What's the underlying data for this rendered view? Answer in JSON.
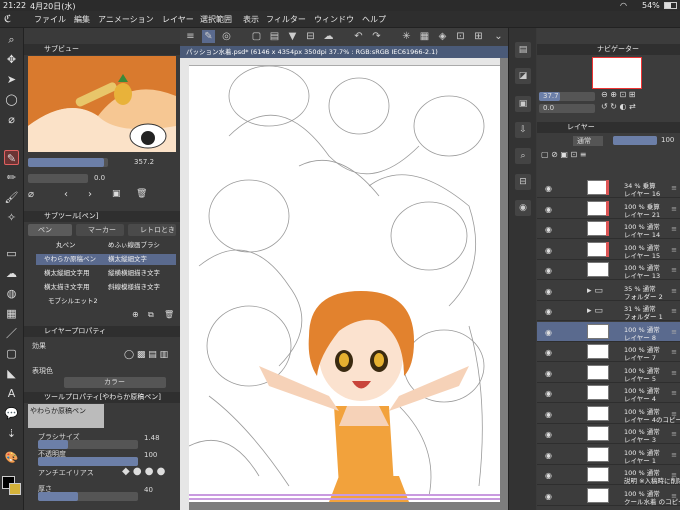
{
  "status": {
    "time": "21:22",
    "date": "4月20日(水)",
    "battery": "54%"
  },
  "menu": [
    "ファイル",
    "編集",
    "アニメーション",
    "レイヤー",
    "選択範囲",
    "表示",
    "フィルター",
    "ウィンドウ",
    "ヘルプ"
  ],
  "subview": {
    "title": "サブビュー",
    "rotation": "357.2",
    "zoom": "0.0"
  },
  "subtool": {
    "title": "サブツール[ペン]",
    "tabs": [
      "ペン",
      "マーカー",
      "レトロとき"
    ],
    "items": [
      {
        "left": "丸ペン",
        "right": "めふぃ線画ブラシ"
      },
      {
        "left": "やわらか原稿ペン",
        "right": "横太縦細文字"
      },
      {
        "left": "横太縦細文字用",
        "right": "縦横横細描き文字"
      },
      {
        "left": "横太描き文字用",
        "right": "斜線模様描き文字"
      },
      {
        "left": "モブシルエット2",
        "right": ""
      }
    ]
  },
  "layerprop": {
    "title": "レイヤープロパティ",
    "effect": "効果",
    "expression_label": "表現色",
    "expression_value": "カラー"
  },
  "toolprop": {
    "title": "ツールプロパティ[やわらか原稿ペン]",
    "brush_name": "やわらか原稿ペン",
    "size_label": "ブラシサイズ",
    "size_value": "1.48",
    "size_fill": 0.3,
    "opacity_label": "不透明度",
    "opacity_value": "100",
    "opacity_fill": 1.0,
    "aa_label": "アンチエイリアス",
    "thickness_label": "厚さ",
    "thickness_value": "40",
    "thickness_fill": 0.4
  },
  "canvas": {
    "tab": "パッション水着.psd* (6146 x 4354px 350dpi 37.7% : RGB:sRGB IEC61966-2.1)"
  },
  "navigator": {
    "title": "ナビゲーター",
    "zoom": "37.7",
    "rotation": "0.0"
  },
  "layers": {
    "title": "レイヤー",
    "blend": "通常",
    "opacity": "100",
    "items": [
      {
        "l1": "34 % 乗算",
        "l2": "レイヤー 16",
        "red": true
      },
      {
        "l1": "100 % 乗算",
        "l2": "レイヤー 21",
        "red": true
      },
      {
        "l1": "100 % 通常",
        "l2": "レイヤー 14",
        "red": true
      },
      {
        "l1": "100 % 通常",
        "l2": "レイヤー 15",
        "red": true
      },
      {
        "l1": "100 % 通常",
        "l2": "レイヤー 13",
        "red": false
      },
      {
        "l1": "35 % 通常",
        "l2": "フォルダー 2",
        "folder": true
      },
      {
        "l1": "31 % 通常",
        "l2": "フォルダー 1",
        "folder": true
      },
      {
        "l1": "100 % 通常",
        "l2": "レイヤー 8",
        "sel": true
      },
      {
        "l1": "100 % 通常",
        "l2": "レイヤー 7"
      },
      {
        "l1": "100 % 通常",
        "l2": "レイヤー 5"
      },
      {
        "l1": "100 % 通常",
        "l2": "レイヤー 4"
      },
      {
        "l1": "100 % 通常",
        "l2": "レイヤー 4のコピー"
      },
      {
        "l1": "100 % 通常",
        "l2": "レイヤー 3"
      },
      {
        "l1": "100 % 通常",
        "l2": "レイヤー 1"
      },
      {
        "l1": "100 % 通常",
        "l2": "説明 ※入稿時に削除して"
      },
      {
        "l1": "100 % 通常",
        "l2": "クール水着 のコピー 2"
      }
    ]
  }
}
